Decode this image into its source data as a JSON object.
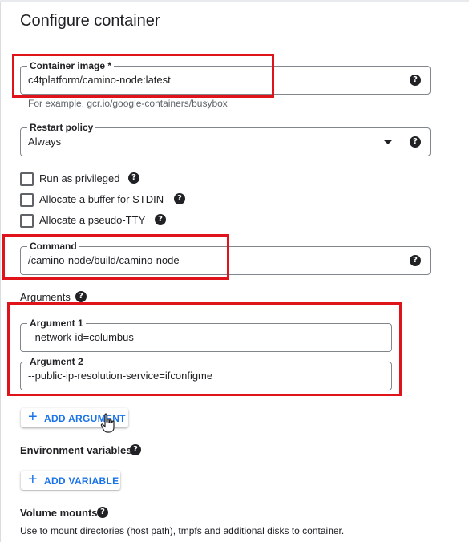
{
  "title": "Configure container",
  "container_image": {
    "label": "Container image *",
    "value": "c4tplatform/camino-node:latest",
    "hint": "For example, gcr.io/google-containers/busybox"
  },
  "restart_policy": {
    "label": "Restart policy",
    "value": "Always"
  },
  "checkboxes": [
    {
      "label": "Run as privileged",
      "checked": false
    },
    {
      "label": "Allocate a buffer for STDIN",
      "checked": false
    },
    {
      "label": "Allocate a pseudo-TTY",
      "checked": false
    }
  ],
  "command": {
    "label": "Command",
    "value": "/camino-node/build/camino-node"
  },
  "arguments": {
    "heading": "Arguments",
    "items": [
      {
        "label": "Argument 1",
        "value": "--network-id=columbus"
      },
      {
        "label": "Argument 2",
        "value": "--public-ip-resolution-service=ifconfigme"
      }
    ],
    "add_button": "ADD ARGUMENT"
  },
  "environment": {
    "heading": "Environment variables",
    "add_button": "ADD VARIABLE"
  },
  "volume_mounts": {
    "heading": "Volume mounts",
    "description": "Use to mount directories (host path), tmpfs and additional disks to container."
  },
  "icons": {
    "help": "?",
    "plus": "+"
  },
  "colors": {
    "accent": "#1a73e8",
    "highlight": "#e0131b"
  }
}
